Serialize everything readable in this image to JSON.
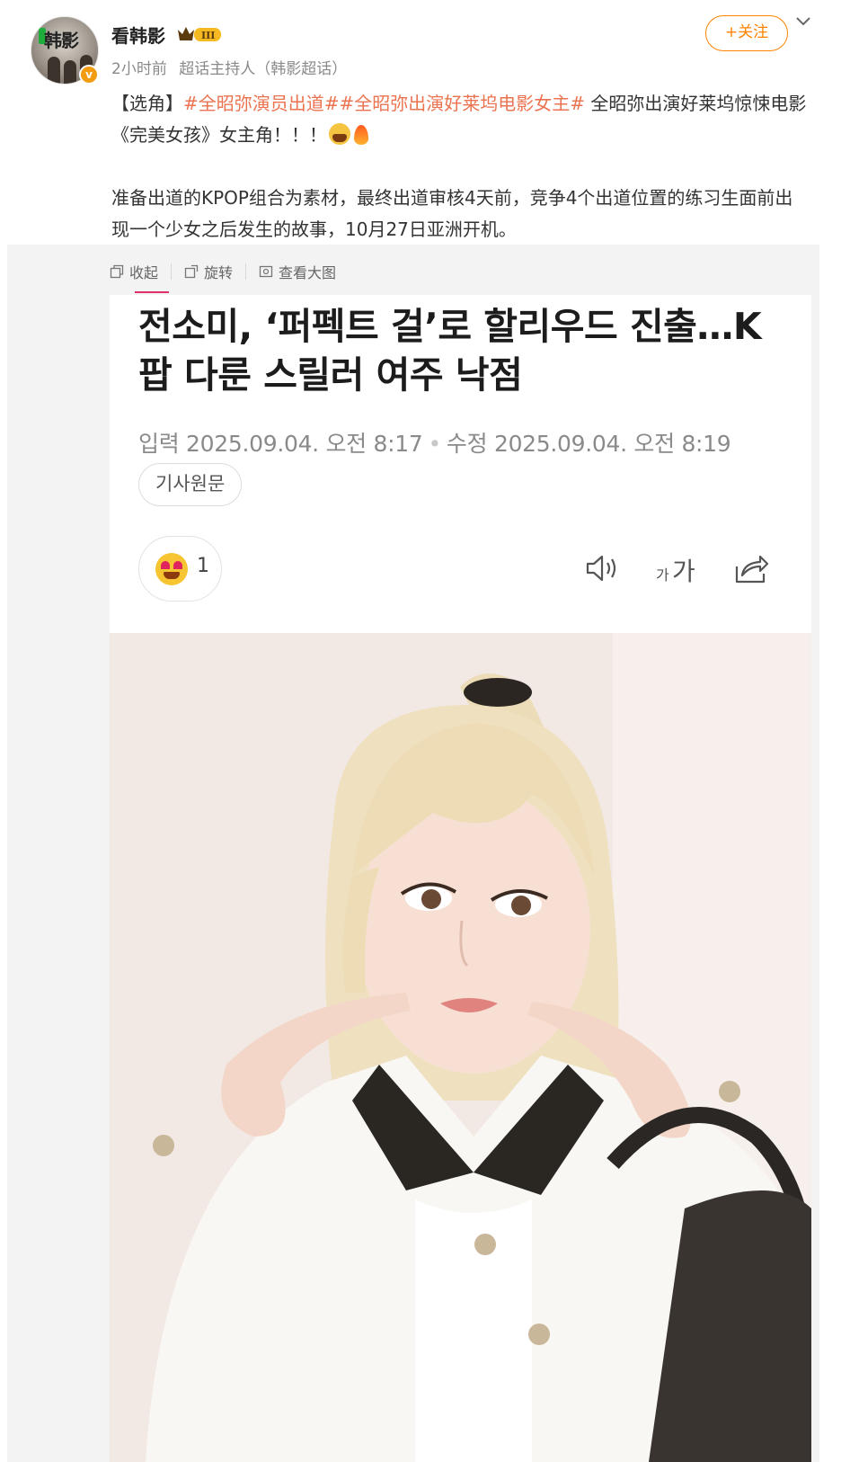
{
  "header": {
    "username": "看韩影",
    "time": "2小时前",
    "role": "超话主持人（韩影超话）",
    "follow_label": "+关注",
    "verified_mark": "v",
    "level_badge": "III"
  },
  "avatar": {
    "text": "韩影"
  },
  "post": {
    "prefix": "【选角】",
    "hashtag_1": "#全昭弥演员出道#",
    "hashtag_2": "#全昭弥出演好莱坞电影女主#",
    "line_1_rest": " 全昭弥出演好莱坞惊悚电影《完美女孩》女主角！！！",
    "paragraph_2": "准备出道的KPOP组合为素材，最终出道审核4天前，竞争4个出道位置的练习生面前出现一个少女之后发生的故事，10月27日亚洲开机。"
  },
  "toolbar": {
    "collapse_label": "收起",
    "rotate_label": "旋转",
    "view_large_label": "查看大图"
  },
  "article": {
    "headline": "전소미, ‘퍼펙트 걸’로 할리우드 진출…K팝 다룬 스릴러 여주 낙점",
    "date_input": "입력 2025.09.04. 오전 8:17",
    "date_edit": "수정 2025.09.04. 오전 8:19",
    "original_button": "기사원문",
    "reaction_count": "1",
    "font_small": "가",
    "font_big": "가"
  },
  "colors": {
    "accent": "#ff8200",
    "hashtag": "#eb7350",
    "underline": "#e0306a"
  },
  "icons": [
    "avatar",
    "verified-badge-icon",
    "crown-level-icon",
    "chevron-down-icon",
    "collapse-icon",
    "rotate-icon",
    "view-large-icon",
    "love-eyes-emoji-icon",
    "speaker-icon",
    "font-size-icon",
    "share-icon",
    "scream-emoji-icon",
    "fire-emoji-icon"
  ]
}
